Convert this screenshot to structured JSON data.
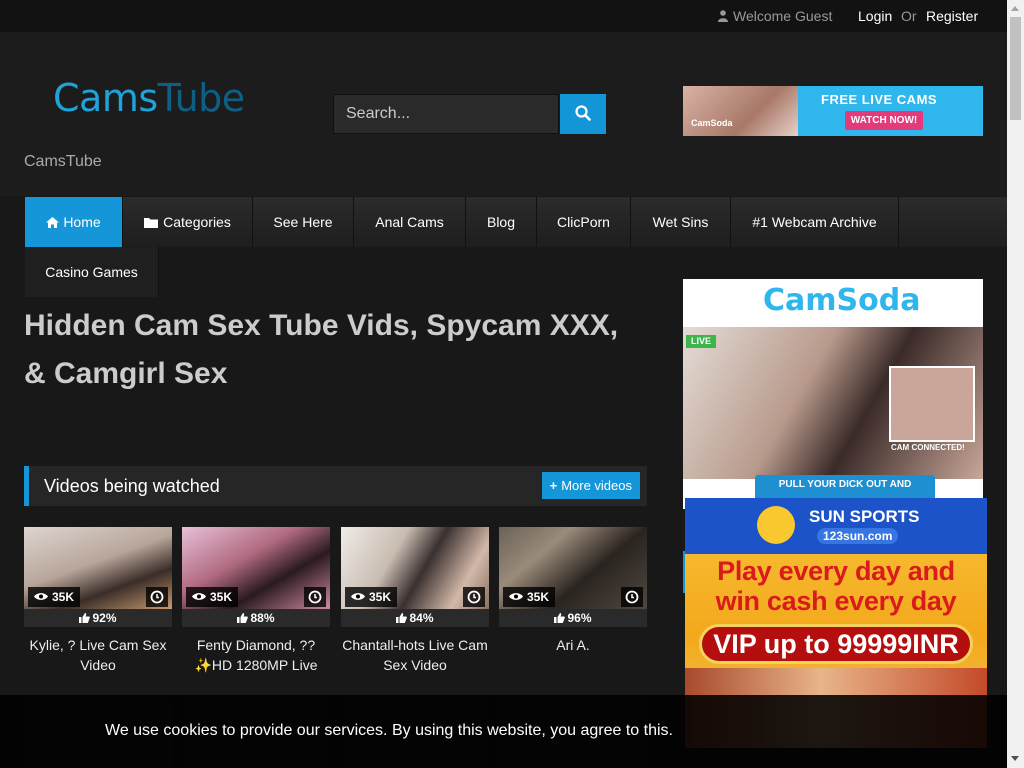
{
  "topbar": {
    "welcome": "Welcome Guest",
    "login": "Login",
    "or": "Or",
    "register": "Register"
  },
  "header": {
    "logo_part1": "Cams",
    "logo_part2": "Tube",
    "tagline": "CamsTube",
    "search_placeholder": "Search..."
  },
  "banner_top": {
    "brand": "CamSoda",
    "headline": "FREE LIVE CAMS",
    "cta": "WATCH NOW!"
  },
  "nav": {
    "items": [
      {
        "label": "Home",
        "icon": "home-icon"
      },
      {
        "label": "Categories",
        "icon": "folder-icon"
      },
      {
        "label": "See Here"
      },
      {
        "label": "Anal Cams"
      },
      {
        "label": "Blog"
      },
      {
        "label": "ClicPorn"
      },
      {
        "label": "Wet Sins"
      },
      {
        "label": "#1 Webcam Archive"
      }
    ],
    "row2": "Casino Games"
  },
  "page_title": "Hidden Cam Sex Tube Vids, Spycam XXX, & Camgirl Sex",
  "section": {
    "title": "Videos being watched",
    "more_label": "More videos"
  },
  "videos": [
    {
      "views": "35K",
      "rating": "92%",
      "title": "Kylie, ? Live Cam Sex Video"
    },
    {
      "views": "35K",
      "rating": "88%",
      "title": "Fenty Diamond, ?? ✨HD 1280MP Live"
    },
    {
      "views": "35K",
      "rating": "84%",
      "title": "Chantall-hots Live Cam Sex Video"
    },
    {
      "views": "35K",
      "rating": "96%",
      "title": "Ari A."
    }
  ],
  "side_ad1": {
    "brand": "CamSoda",
    "live": "LIVE",
    "cam_connected": "CAM CONNECTED!",
    "cta": "PULL YOUR DICK OUT AND"
  },
  "side_ad2": {
    "brand1": "SUN SPORTS",
    "brand2": "123sun.com",
    "line1": "Play every day and",
    "line2": "win cash every day",
    "vip": "VIP up to 99999INR"
  },
  "cookie": {
    "message": "We use cookies to provide our services. By using this website, you agree to this."
  },
  "colors": {
    "accent": "#1496d8",
    "background": "#181818"
  }
}
